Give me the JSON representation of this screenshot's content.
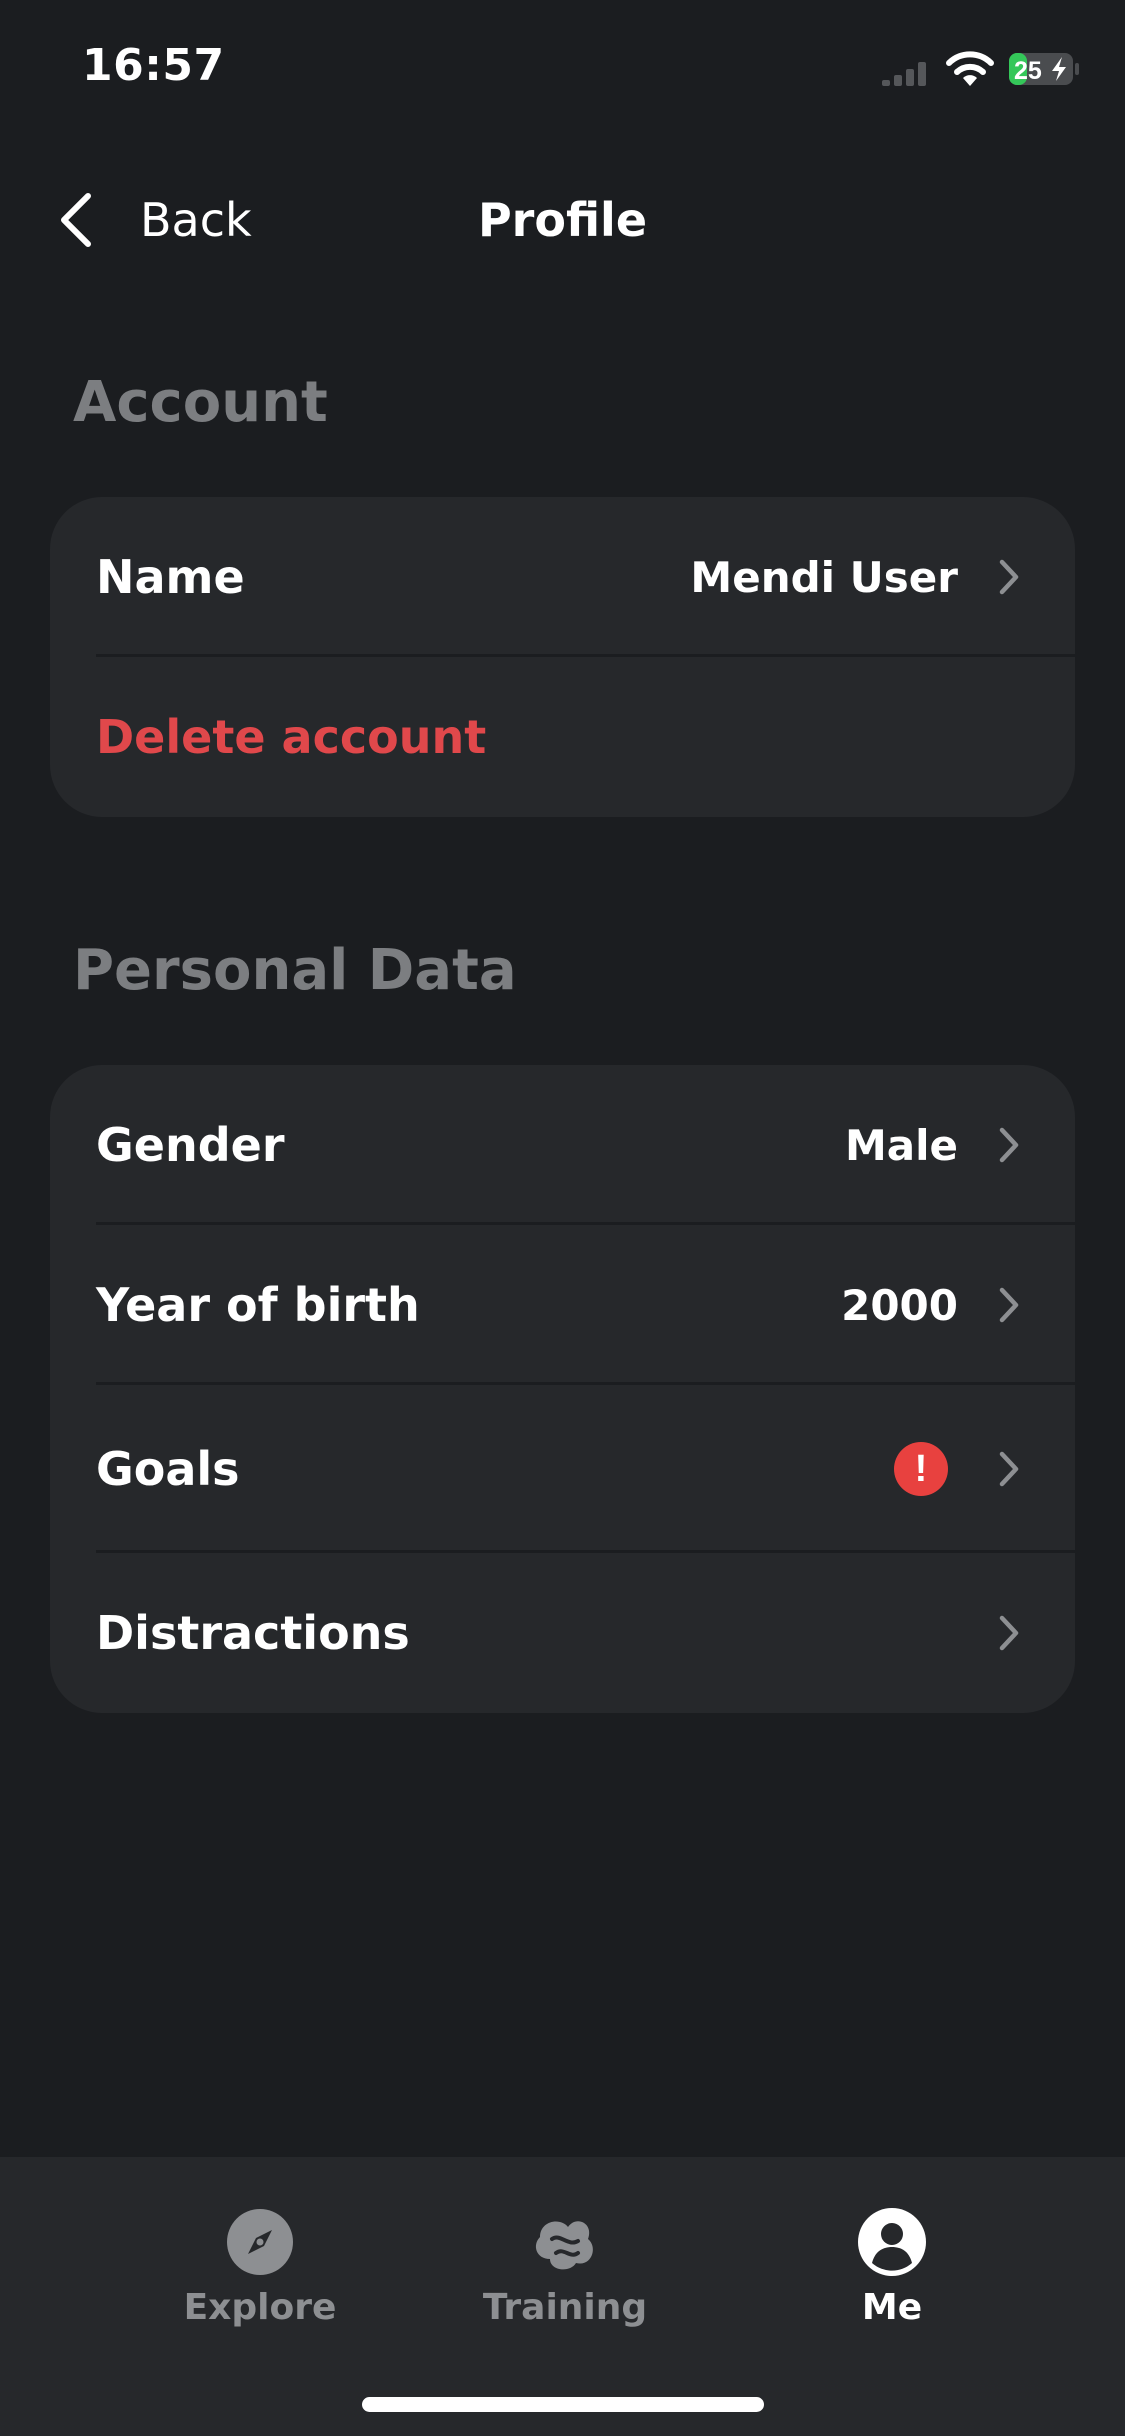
{
  "status_bar": {
    "time": "16:57",
    "battery_level": "25",
    "battery_charging": true,
    "battery_color": "#34c759"
  },
  "nav": {
    "back_label": "Back",
    "title": "Profile"
  },
  "account": {
    "heading": "Account",
    "name_label": "Name",
    "name_value": "Mendi User",
    "delete_label": "Delete account"
  },
  "personal_data": {
    "heading": "Personal Data",
    "gender_label": "Gender",
    "gender_value": "Male",
    "birth_label": "Year of birth",
    "birth_value": "2000",
    "goals_label": "Goals",
    "goals_alert": "!",
    "distractions_label": "Distractions"
  },
  "tabs": [
    {
      "label": "Explore",
      "icon": "compass-icon",
      "active": false
    },
    {
      "label": "Training",
      "icon": "brain-icon",
      "active": false
    },
    {
      "label": "Me",
      "icon": "person-icon",
      "active": true
    }
  ],
  "colors": {
    "background": "#1b1d20",
    "card": "#26282b",
    "danger": "#e0484b",
    "alert": "#e8413f",
    "muted": "#7c7e81"
  }
}
